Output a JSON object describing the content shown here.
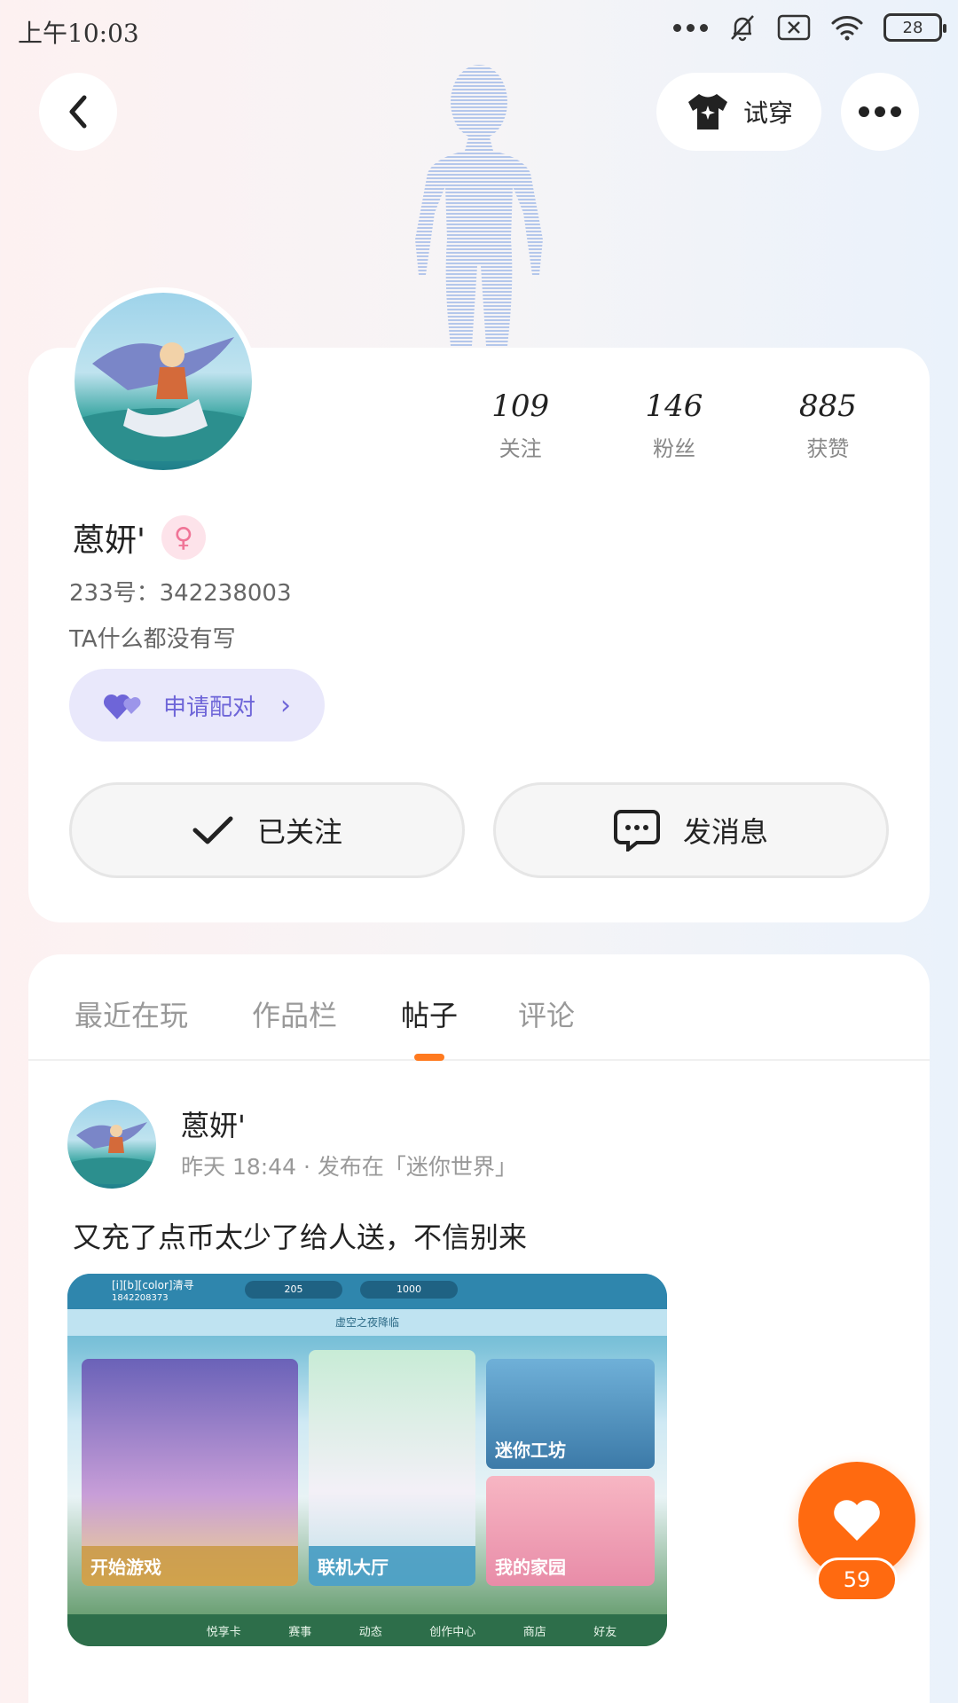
{
  "status": {
    "time": "上午10:03",
    "battery": "28"
  },
  "header": {
    "try_on_label": "试穿"
  },
  "profile": {
    "stats": [
      {
        "value": "109",
        "label": "关注"
      },
      {
        "value": "146",
        "label": "粉丝"
      },
      {
        "value": "885",
        "label": "获赞"
      }
    ],
    "username": "蒽妍'",
    "gender_icon": "♀",
    "uid": "233号：342238003",
    "bio": "TA什么都没有写",
    "pair_label": "申请配对",
    "follow_label": "已关注",
    "message_label": "发消息"
  },
  "tabs": [
    {
      "label": "最近在玩",
      "active": false
    },
    {
      "label": "作品栏",
      "active": false
    },
    {
      "label": "帖子",
      "active": true
    },
    {
      "label": "评论",
      "active": false
    }
  ],
  "post": {
    "author": "蒽妍'",
    "meta": "昨天 18:44 · 发布在「迷你世界」",
    "text": "又充了点币太少了给人送，不信别来",
    "screenshot": {
      "player_name": "[i][b][color]清寻",
      "player_id": "1842208373",
      "coin1": "205",
      "coin2": "1000",
      "banner": "虚空之夜降临",
      "tiles": [
        "开始游戏",
        "联机大厅",
        "迷你工坊",
        "我的家园"
      ],
      "bottom_nav": [
        "悦享卡",
        "赛事",
        "动态",
        "创作中心",
        "商店",
        "好友"
      ]
    }
  },
  "like": {
    "count": "59"
  },
  "colors": {
    "accent": "#ff6a10",
    "pair": "#6e65d8"
  }
}
